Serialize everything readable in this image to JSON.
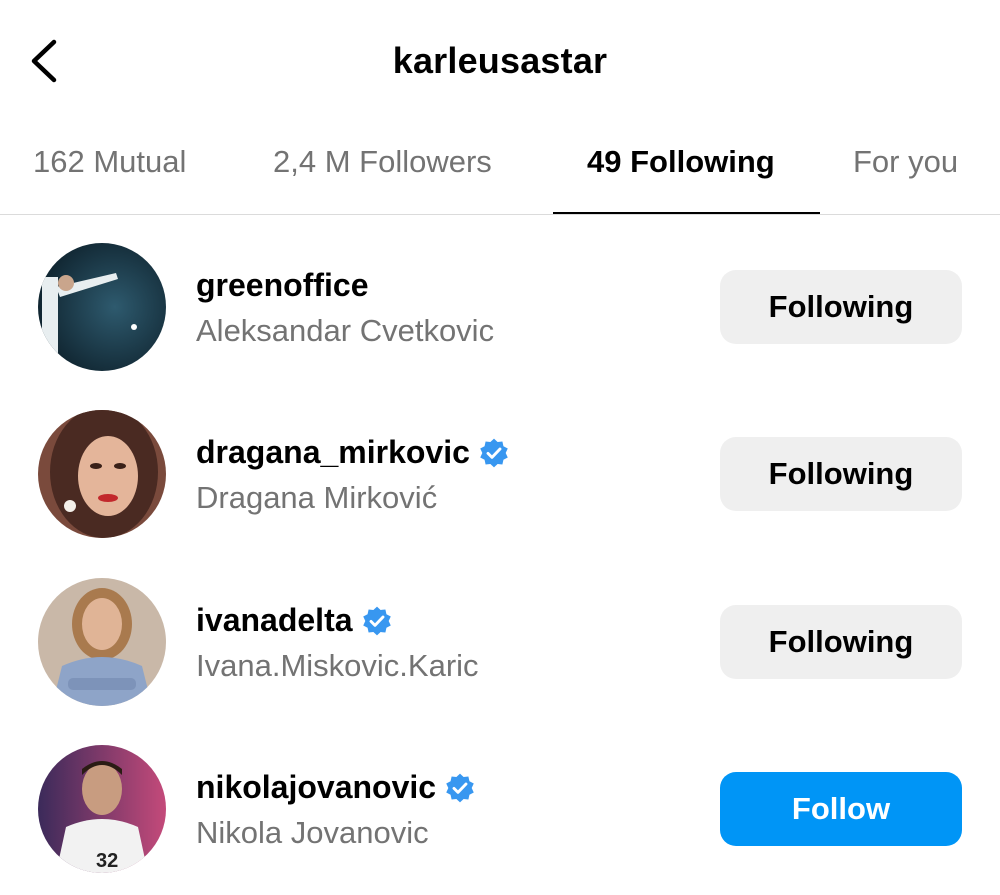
{
  "header": {
    "title": "karleusastar",
    "back_icon": "chevron-left-icon"
  },
  "tabs": [
    {
      "label": "162 Mutual",
      "active": false
    },
    {
      "label": "2,4 M Followers",
      "active": false
    },
    {
      "label": "49 Following",
      "active": true
    },
    {
      "label": "For you",
      "active": false
    }
  ],
  "accounts": [
    {
      "username": "greenoffice",
      "full_name": "Aleksandar Cvetkovic",
      "verified": false,
      "button": "Following"
    },
    {
      "username": "dragana_mirkovic",
      "full_name": "Dragana Mirković",
      "verified": true,
      "button": "Following"
    },
    {
      "username": "ivanadelta",
      "full_name": "Ivana.Miskovic.Karic",
      "verified": true,
      "button": "Following"
    },
    {
      "username": "nikolajovanovic",
      "full_name": "Nikola Jovanovic",
      "verified": true,
      "button": "Follow"
    }
  ],
  "avatar_jersey_number": "32",
  "colors": {
    "follow_button": "#0095f6",
    "following_button": "#efefef",
    "verified_badge": "#3897f0",
    "secondary_text": "#737373"
  }
}
